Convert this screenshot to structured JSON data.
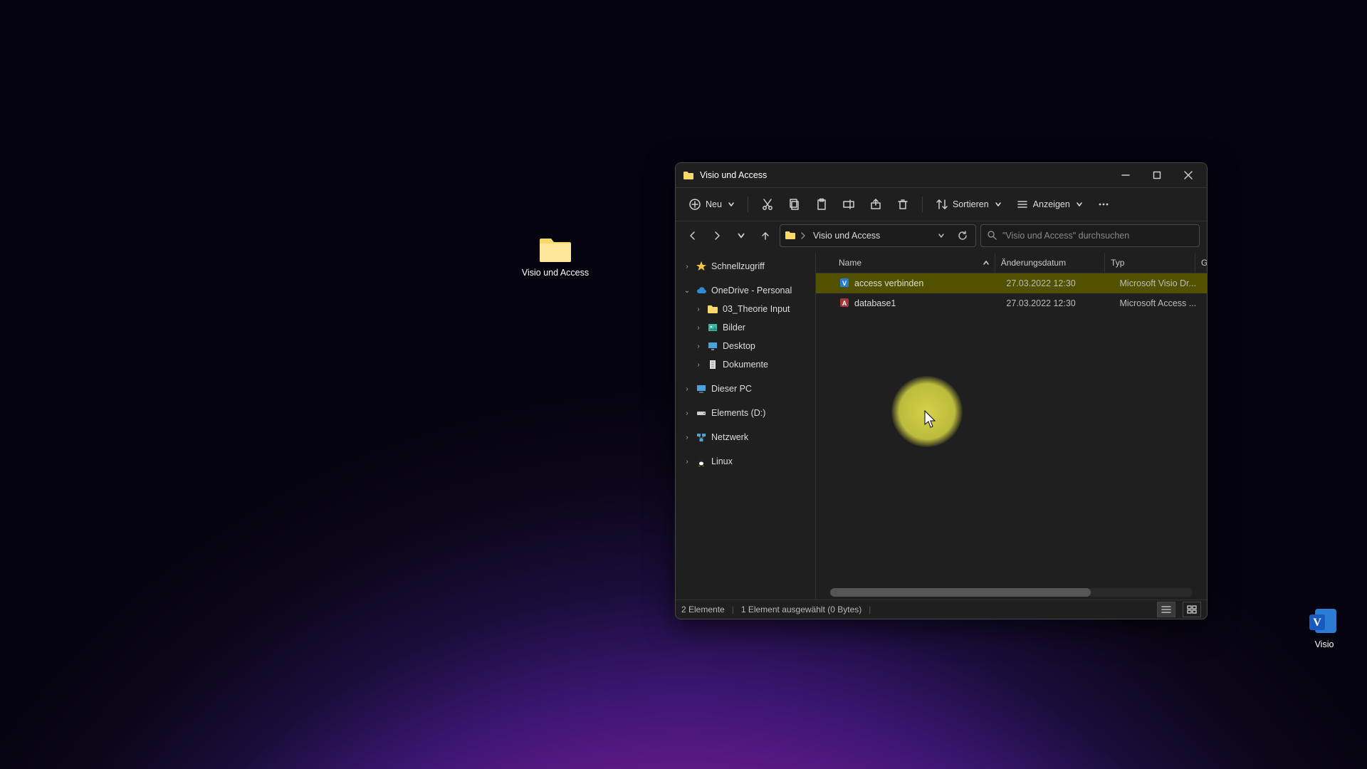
{
  "desktop_icons": {
    "folder": {
      "label": "Visio und Access"
    },
    "visio": {
      "label": "Visio"
    }
  },
  "window": {
    "title": "Visio und Access"
  },
  "toolbar": {
    "new_label": "Neu",
    "sort_label": "Sortieren",
    "view_label": "Anzeigen"
  },
  "address": {
    "crumb": "Visio und Access"
  },
  "search": {
    "placeholder": "\"Visio und Access\" durchsuchen"
  },
  "navtree": {
    "quick_access": "Schnellzugriff",
    "onedrive": "OneDrive - Personal",
    "onedrive_children": {
      "theorie": "03_Theorie Input",
      "bilder": "Bilder",
      "desktop": "Desktop",
      "dokumente": "Dokumente"
    },
    "this_pc": "Dieser PC",
    "elements": "Elements (D:)",
    "network": "Netzwerk",
    "linux": "Linux"
  },
  "columns": {
    "name": "Name",
    "date": "Änderungsdatum",
    "type": "Typ",
    "size": "Gr"
  },
  "files": [
    {
      "name": "access verbinden",
      "date": "27.03.2022 12:30",
      "type": "Microsoft Visio Dr..."
    },
    {
      "name": "database1",
      "date": "27.03.2022 12:30",
      "type": "Microsoft Access ..."
    }
  ],
  "status": {
    "count": "2 Elemente",
    "selected": "1 Element ausgewählt (0 Bytes)"
  }
}
